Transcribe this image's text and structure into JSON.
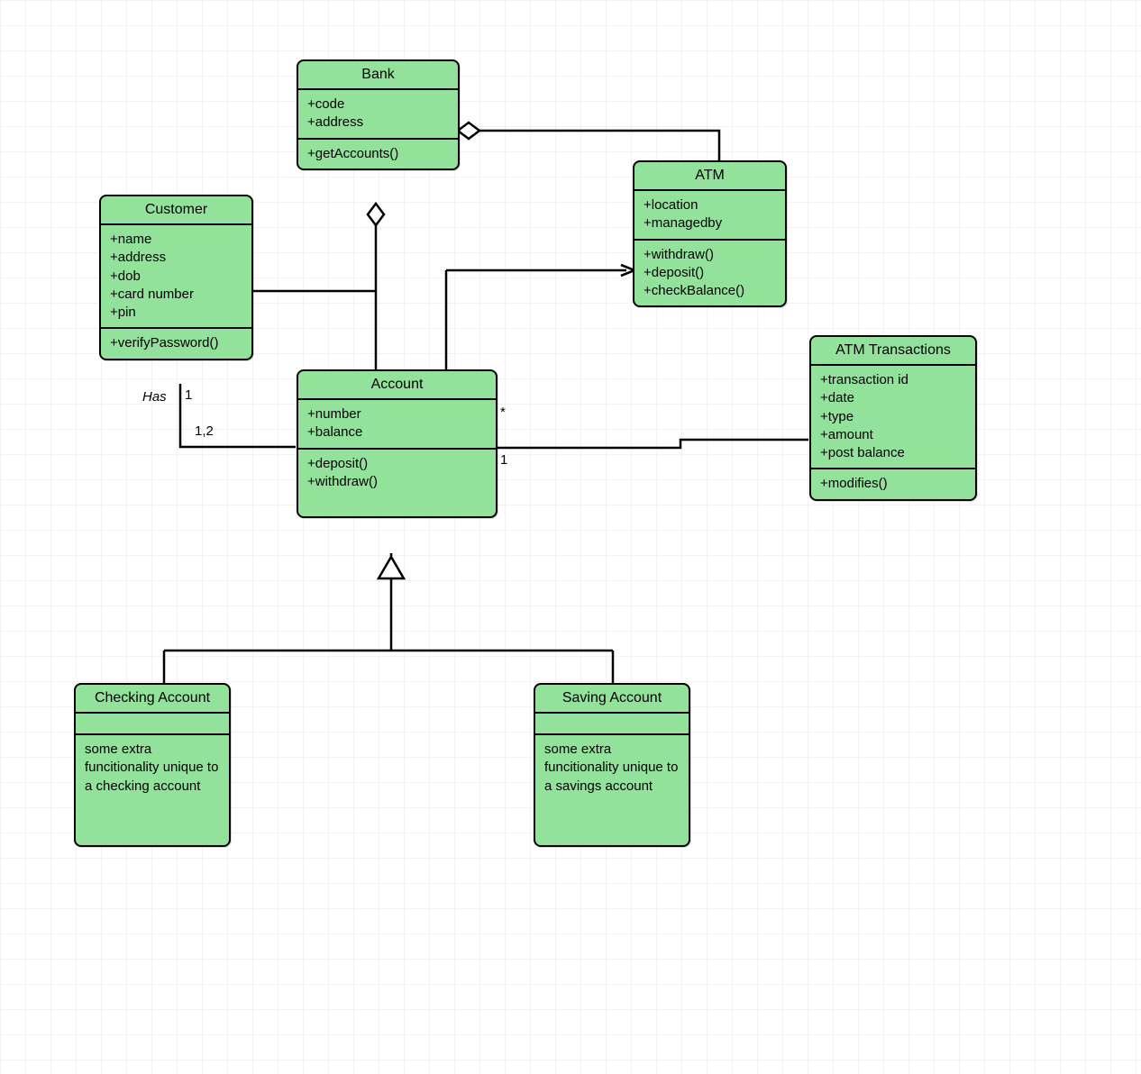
{
  "classes": {
    "bank": {
      "title": "Bank",
      "attrs": [
        "+code",
        "+address"
      ],
      "ops": [
        "+getAccounts()"
      ]
    },
    "customer": {
      "title": "Customer",
      "attrs": [
        "+name",
        "+address",
        "+dob",
        "+card number",
        "+pin"
      ],
      "ops": [
        "+verifyPassword()"
      ]
    },
    "atm": {
      "title": "ATM",
      "attrs": [
        "+location",
        "+managedby"
      ],
      "ops": [
        "+withdraw()",
        "+deposit()",
        "+checkBalance()"
      ]
    },
    "account": {
      "title": "Account",
      "attrs": [
        "+number",
        "+balance"
      ],
      "ops": [
        "+deposit()",
        "+withdraw()"
      ]
    },
    "atm_tx": {
      "title": "ATM Transactions",
      "attrs": [
        "+transaction id",
        "+date",
        "+type",
        "+amount",
        "+post balance"
      ],
      "ops": [
        "+modifies()"
      ]
    },
    "checking": {
      "title": "Checking Account",
      "attrs_empty": true,
      "note": "some extra funcitionality unique to a checking account"
    },
    "saving": {
      "title": "Saving Account",
      "attrs_empty": true,
      "note": "some extra funcitionality unique to a savings account"
    }
  },
  "labels": {
    "has": "Has",
    "one": "1",
    "one_two": "1,2",
    "star": "*",
    "one_b": "1"
  }
}
